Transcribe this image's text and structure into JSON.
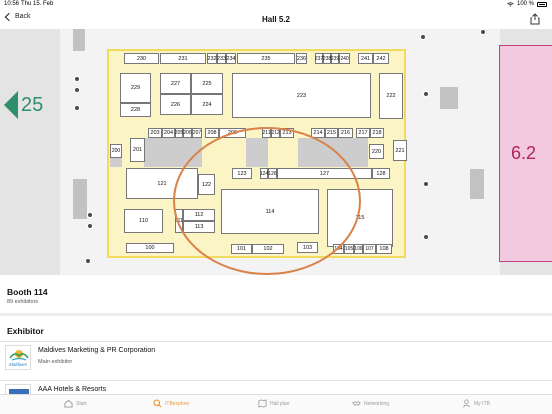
{
  "status": {
    "time": "10:56",
    "date": "Thu 15. Feb",
    "battery": "100 %"
  },
  "nav": {
    "back_label": "Back",
    "title": "Hall 5.2"
  },
  "map": {
    "booths": [
      "230",
      "231",
      "232",
      "233",
      "234",
      "235",
      "236",
      "237",
      "238",
      "239",
      "240",
      "241",
      "242",
      "229",
      "227",
      "225",
      "228",
      "226",
      "224",
      "223",
      "222",
      "201",
      "203",
      "204",
      "205",
      "206",
      "207",
      "208",
      "209",
      "211",
      "212",
      "213",
      "214",
      "215",
      "216",
      "217",
      "218",
      "200",
      "220",
      "221",
      "123",
      "124",
      "126",
      "127",
      "128",
      "121",
      "122",
      "110",
      "111",
      "112",
      "113",
      "114",
      "115",
      "100",
      "101",
      "102",
      "103",
      "104",
      "105",
      "106",
      "107",
      "108"
    ],
    "adjacent_hall": "6.2",
    "hall_arrow": "25",
    "accent_color": "#d9834a"
  },
  "booth_panel": {
    "title": "Booth 114",
    "subtitle": "89 exhibitors"
  },
  "exhibitor_section": {
    "title": "Exhibitor"
  },
  "exhibitors": [
    {
      "name": "Maldives Marketing & PR Corporation",
      "role": "Main exhibitor",
      "logo": "maldives-logo",
      "logo_text": "Maldives"
    },
    {
      "name": "AAA Hotels & Resorts",
      "role": "",
      "logo": "aaa-logo"
    }
  ],
  "tabs": [
    {
      "label": "Start",
      "icon": "home-icon"
    },
    {
      "label": "ITBexplore",
      "icon": "search-icon",
      "active": true
    },
    {
      "label": "Hall plan",
      "icon": "map-icon"
    },
    {
      "label": "Networking",
      "icon": "handshake-icon"
    },
    {
      "label": "My ITB",
      "icon": "person-icon"
    }
  ]
}
